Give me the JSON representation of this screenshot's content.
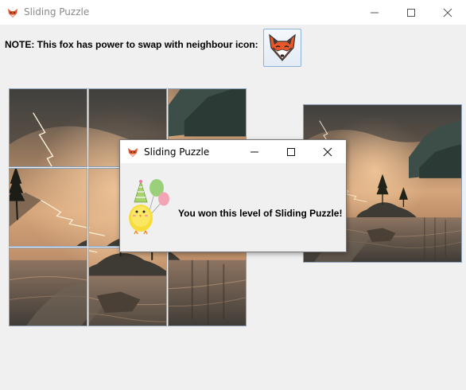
{
  "window": {
    "title": "Sliding Puzzle",
    "app_icon": "fox-icon",
    "controls": [
      "minimize-icon",
      "maximize-icon",
      "close-icon"
    ]
  },
  "note": {
    "text": "NOTE: This fox has power to swap with neighbour icon:"
  },
  "fox_button": {
    "icon": "fox-face-icon"
  },
  "puzzle": {
    "rows": 3,
    "cols": 3,
    "tiles": [
      "tile-1",
      "tile-2",
      "tile-3",
      "tile-4",
      "tile-5",
      "tile-6",
      "tile-7",
      "tile-8",
      "tile-9"
    ]
  },
  "preview": {
    "image": "lake-landscape-preview"
  },
  "dialog": {
    "title": "Sliding Puzzle",
    "app_icon": "fox-icon",
    "message": "You won this level of Sliding Puzzle!",
    "illustration": "party-chick-icon"
  }
}
